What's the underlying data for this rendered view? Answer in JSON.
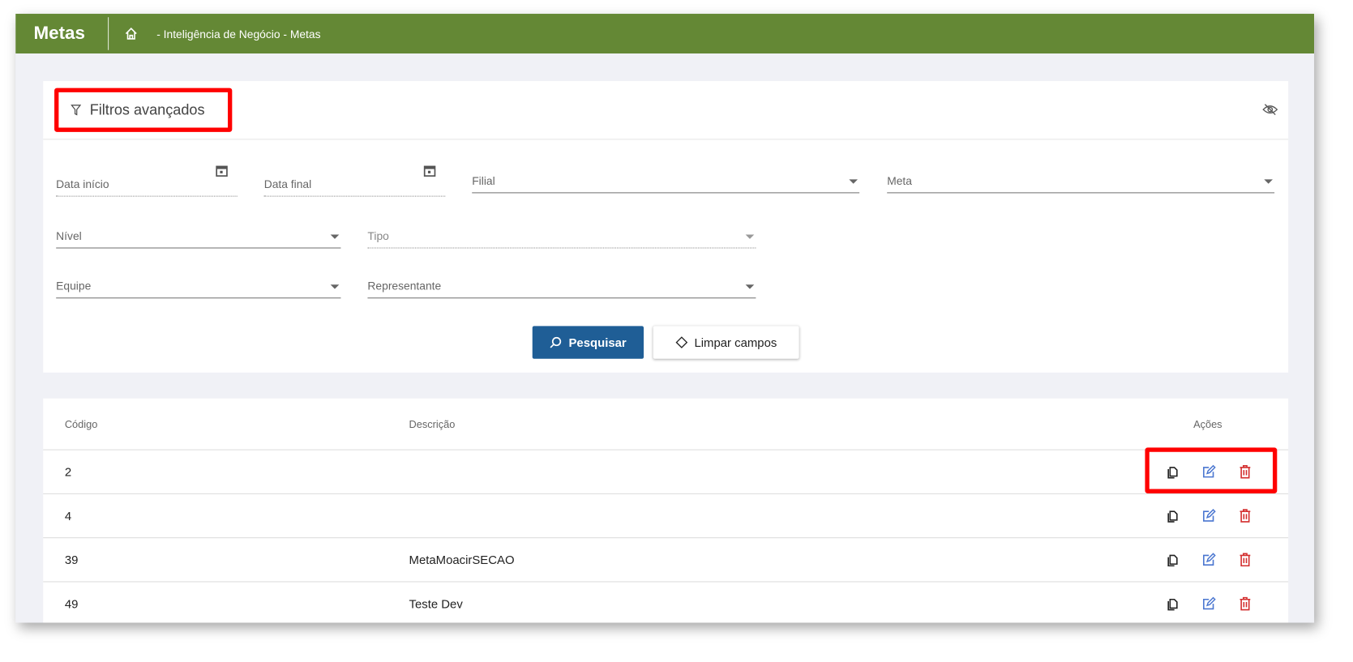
{
  "header": {
    "title": "Metas",
    "breadcrumb": "- Inteligência de Negócio - Metas"
  },
  "filters": {
    "title": "Filtros avançados",
    "data_inicio": "Data início",
    "data_final": "Data final",
    "filial": "Filial",
    "meta": "Meta",
    "nivel": "Nível",
    "tipo": "Tipo",
    "equipe": "Equipe",
    "representante": "Representante",
    "search_label": "Pesquisar",
    "clear_label": "Limpar campos"
  },
  "table": {
    "headers": [
      "Código",
      "Descrição",
      "Ações"
    ],
    "rows": [
      {
        "codigo": "2",
        "descricao": ""
      },
      {
        "codigo": "4",
        "descricao": ""
      },
      {
        "codigo": "39",
        "descricao": "MetaMoacirSECAO"
      },
      {
        "codigo": "49",
        "descricao": "Teste Dev"
      }
    ]
  },
  "colors": {
    "header": "#648835",
    "primary": "#1f5e96",
    "edit": "#4a76d0",
    "delete": "#d32f2f",
    "highlight": "#ff0000"
  }
}
